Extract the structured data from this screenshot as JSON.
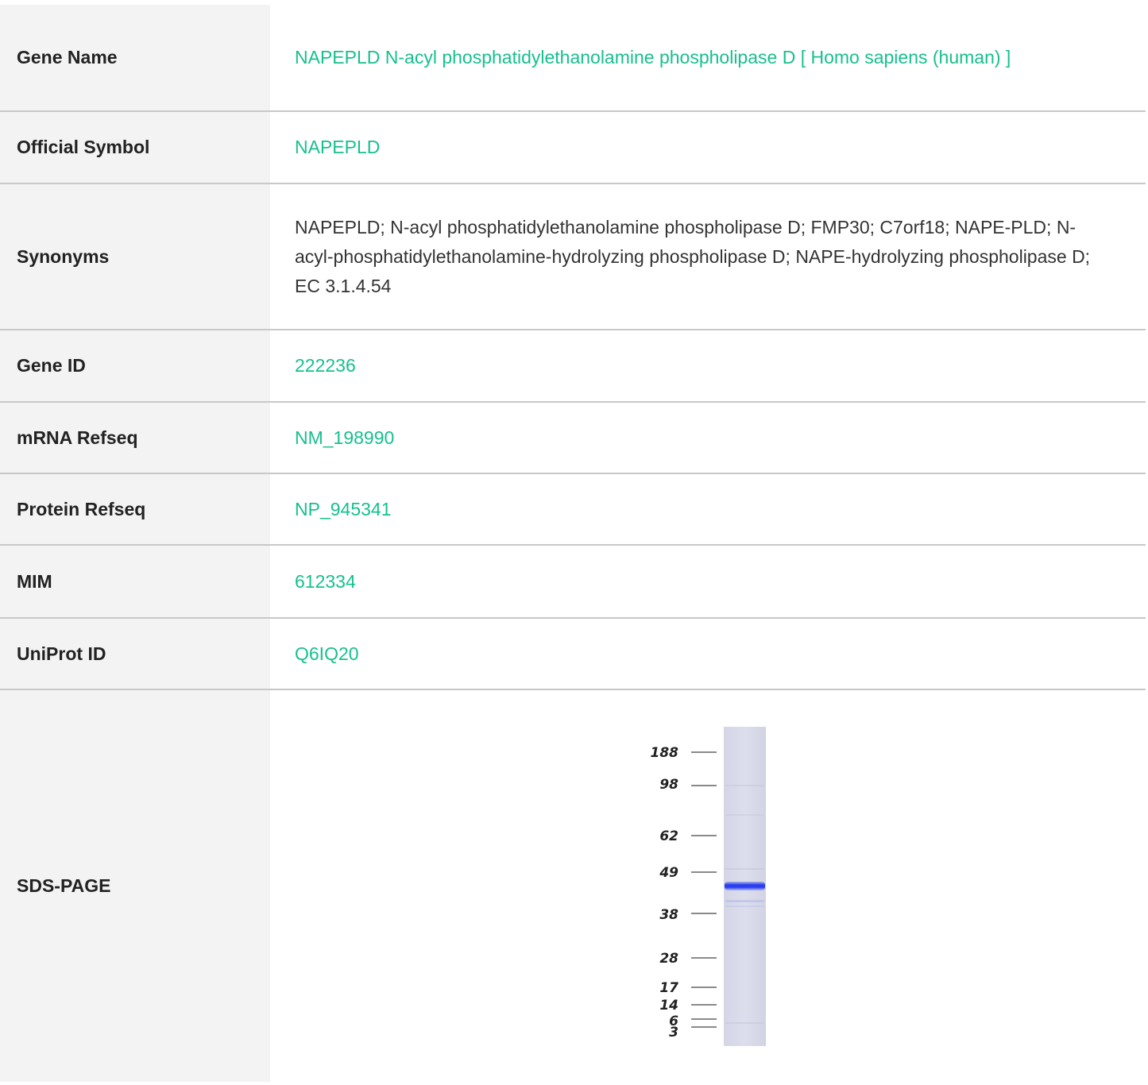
{
  "rows": [
    {
      "label": "Gene Name",
      "value": "NAPEPLD N-acyl phosphatidylethanolamine phospholipase D [ Homo sapiens (human) ]",
      "link": true
    },
    {
      "label": "Official Symbol",
      "value": "NAPEPLD",
      "link": true
    },
    {
      "label": "Synonyms",
      "value": "NAPEPLD; N-acyl phosphatidylethanolamine phospholipase D; FMP30; C7orf18; NAPE-PLD; N-acyl-phosphatidylethanolamine-hydrolyzing phospholipase D; NAPE-hydrolyzing phospholipase D; EC 3.1.4.54",
      "link": false
    },
    {
      "label": "Gene ID",
      "value": "222236",
      "link": true
    },
    {
      "label": "mRNA Refseq",
      "value": "NM_198990",
      "link": true
    },
    {
      "label": "Protein Refseq",
      "value": "NP_945341",
      "link": true
    },
    {
      "label": "MIM",
      "value": "612334",
      "link": true
    },
    {
      "label": "UniProt ID",
      "value": "Q6IQ20",
      "link": true
    },
    {
      "label": "SDS-PAGE",
      "value": "",
      "link": false
    }
  ],
  "gel": {
    "markers": [
      "188",
      "98",
      "62",
      "49",
      "38",
      "28",
      "17",
      "14",
      "6",
      "3"
    ],
    "band_color": "#2a3ff0"
  },
  "colors": {
    "link": "#17c08e",
    "label_bg": "#f3f3f3",
    "divider": "#c8c8c8"
  }
}
